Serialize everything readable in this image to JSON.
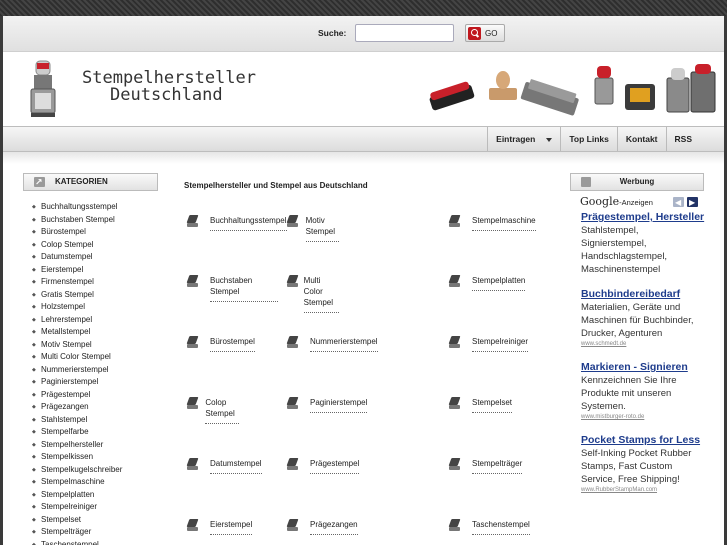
{
  "search": {
    "label": "Suche:",
    "value": "",
    "placeholder": "",
    "go_label": "GO"
  },
  "logo": {
    "line1": "Stempelhersteller",
    "line2": "Deutschland"
  },
  "nav": [
    "Eintragen",
    "Top Links",
    "Kontakt",
    "RSS"
  ],
  "sidebar": {
    "title": "KATEGORIEN",
    "items": [
      "Buchhaltungsstempel",
      "Buchstaben Stempel",
      "Bürostempel",
      "Colop Stempel",
      "Datumstempel",
      "Eierstempel",
      "Firmenstempel",
      "Gratis Stempel",
      "Holzstempel",
      "Lehrerstempel",
      "Metallstempel",
      "Motiv Stempel",
      "Multi Color Stempel",
      "Nummerierstempel",
      "Paginierstempel",
      "Prägestempel",
      "Prägezangen",
      "Stahlstempel",
      "Stempelfarbe",
      "Stempelhersteller",
      "Stempelkissen",
      "Stempelkugelschreiber",
      "Stempelmaschine",
      "Stempelplatten",
      "Stempelreiniger",
      "Stempelset",
      "Stempelträger",
      "Taschenstempel"
    ]
  },
  "main": {
    "title": "Stempelhersteller und Stempel aus Deutschland",
    "rows": [
      [
        "Buchhaltungsstempel",
        "Motiv Stempel",
        "Stempelmaschine"
      ],
      [
        "Buchstaben Stempel",
        "Multi Color Stempel",
        "Stempelplatten"
      ],
      [
        "Bürostempel",
        "Nummerierstempel",
        "Stempelreiniger"
      ],
      [
        "Colop Stempel",
        "Paginierstempel",
        "Stempelset"
      ],
      [
        "Datumstempel",
        "Prägestempel",
        "Stempelträger"
      ],
      [
        "Eierstempel",
        "Prägezangen",
        "Taschenstempel"
      ]
    ]
  },
  "ads": {
    "title": "Werbung",
    "google": "Google",
    "google_suffix": "-Anzeigen",
    "items": [
      {
        "title": "Prägestempel, Hersteller",
        "text": "Stahlstempel, Signierstempel, Handschlagstempel, Maschinenstempel",
        "url": ""
      },
      {
        "title": "Buchbindereibedarf",
        "text": "Materialien, Geräte und Maschinen für Buchbinder, Drucker, Agenturen",
        "url": "www.schmedt.de"
      },
      {
        "title": "Markieren - Signieren",
        "text": "Kennzeichnen Sie Ihre Produkte mit unseren Systemen.",
        "url": "www.mistburger-roto.de"
      },
      {
        "title": "Pocket Stamps for Less",
        "text": "Self-Inking Pocket Rubber Stamps, Fast Custom Service, Free Shipping!",
        "url": "www.RubberStampMan.com"
      }
    ]
  }
}
